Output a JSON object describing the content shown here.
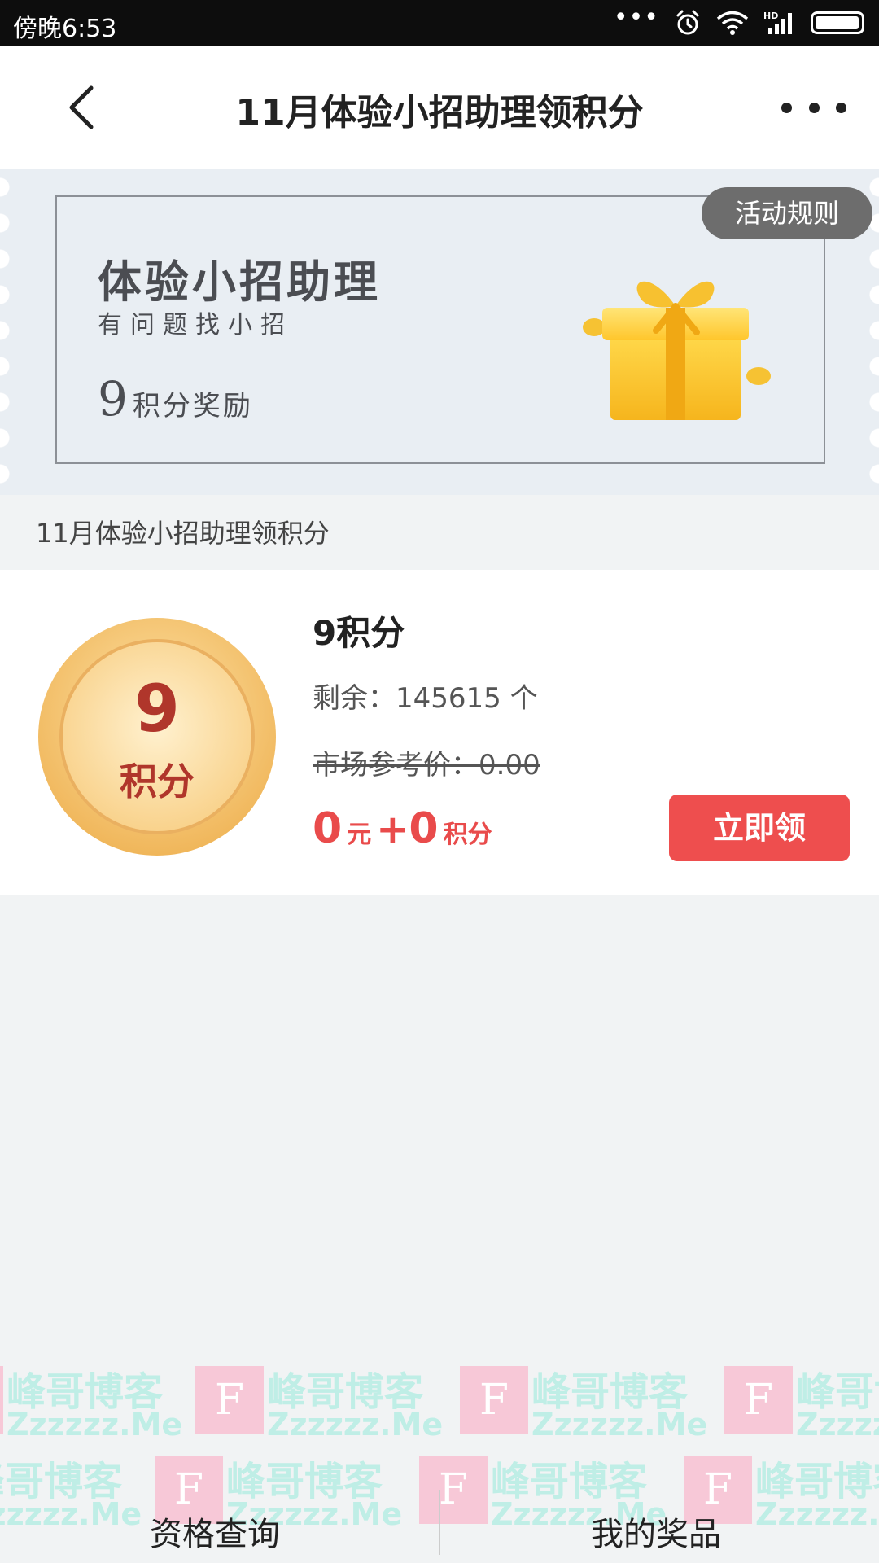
{
  "status_bar": {
    "time": "傍晚6:53",
    "dots": "•••",
    "icons": [
      "alarm-icon",
      "wifi-icon",
      "signal-icon",
      "battery-icon"
    ]
  },
  "nav": {
    "title": "11月体验小招助理领积分",
    "back_icon": "back-arrow-icon",
    "more_icon": "more-dots-icon"
  },
  "banner": {
    "heading": "体验小招助理",
    "sub": "有问题找小招",
    "reward_number": "9",
    "reward_text": "积分奖励",
    "rule_button": "活动规则",
    "gift_icon": "gift-icon"
  },
  "section_label": "11月体验小招助理领积分",
  "item": {
    "coin_number": "9",
    "coin_label": "积分",
    "title": "9积分",
    "remain": "剩余：145615 个",
    "market_price": "市场参考价：0.00",
    "price_yuan": "0",
    "price_yuan_unit": "元",
    "price_plus": "+",
    "price_points": "0",
    "price_points_unit": "积分",
    "claim_button": "立即领"
  },
  "watermark": {
    "cn": "峰哥博客",
    "en": "Zzzzzz.Me",
    "badge": "F"
  },
  "bottom": {
    "left": "资格查询",
    "right": "我的奖品"
  },
  "colors": {
    "accent_red": "#ee4e4e",
    "price_red": "#e94b4b",
    "status_bar": "#0d0d0d",
    "page_bg": "#f1f3f4"
  }
}
